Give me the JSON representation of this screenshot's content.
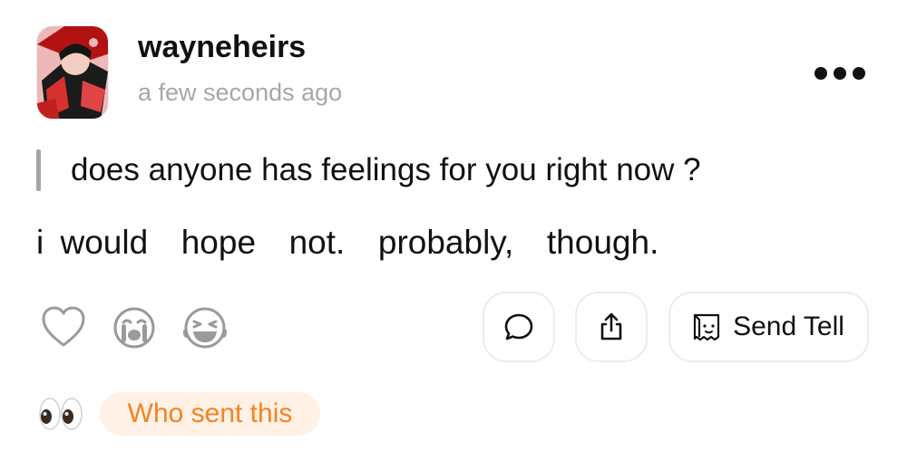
{
  "post": {
    "username": "wayneheirs",
    "timestamp": "a few seconds ago",
    "question": "does anyone has feelings for you right now ?",
    "answer": "i would  hope  not.  probably,  though."
  },
  "icons": {
    "avatar": "profile-picture-anime",
    "more": "more-dots-icon",
    "heart": "heart-icon",
    "cry": "crying-face-icon",
    "laugh": "laughing-face-icon",
    "comment": "comment-bubble-icon",
    "share": "share-icon",
    "tell": "tell-bag-icon",
    "eyes": "eyes-emoji-icon"
  },
  "actions": {
    "send_tell_label": "Send Tell",
    "who_sent_label": "Who sent this"
  },
  "colors": {
    "accent_orange": "#f58220",
    "pill_bg": "#fff1e6",
    "muted_gray": "#a7a7a7"
  }
}
